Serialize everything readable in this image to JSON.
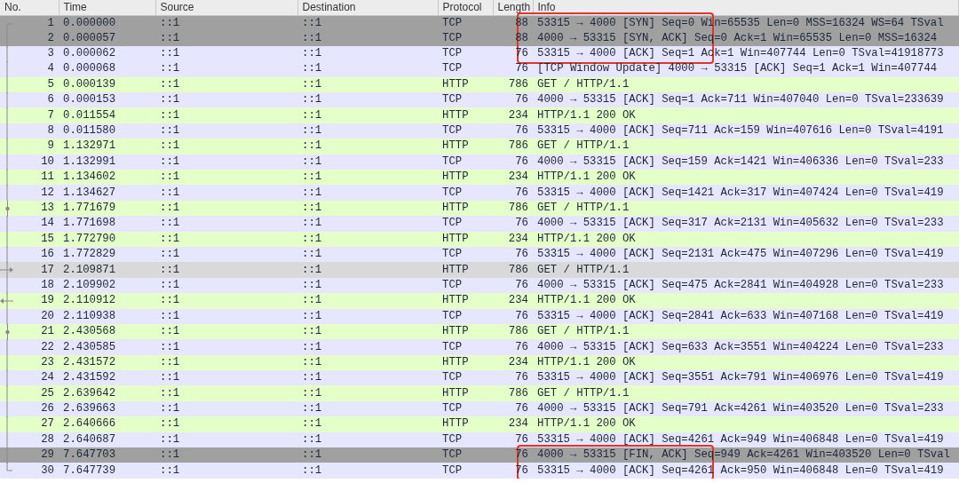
{
  "table": {
    "columns": [
      "No.",
      "Time",
      "Source",
      "Destination",
      "Protocol",
      "Length",
      "Info"
    ],
    "rows": [
      {
        "no": "1",
        "time": "0.000000",
        "source": "::1",
        "destination": "::1",
        "protocol": "TCP",
        "length": "88",
        "info": "53315 → 4000 [SYN] Seq=0 Win=65535 Len=0 MSS=16324 WS=64 TSval",
        "marked": true,
        "selected": false,
        "boxed": true,
        "kind": "first"
      },
      {
        "no": "2",
        "time": "0.000057",
        "source": "::1",
        "destination": "::1",
        "protocol": "TCP",
        "length": "88",
        "info": "4000 → 53315 [SYN, ACK] Seq=0 Ack=1 Win=65535 Len=0 MSS=16324",
        "marked": true,
        "selected": false,
        "boxed": true,
        "kind": "line"
      },
      {
        "no": "3",
        "time": "0.000062",
        "source": "::1",
        "destination": "::1",
        "protocol": "TCP",
        "length": "76",
        "info": "53315 → 4000 [ACK] Seq=1 Ack=1 Win=407744 Len=0 TSval=41918773",
        "color": "#e7e6ff",
        "marked": false,
        "selected": false,
        "boxed": true,
        "kind": "line"
      },
      {
        "no": "4",
        "time": "0.000068",
        "source": "::1",
        "destination": "::1",
        "protocol": "TCP",
        "length": "76",
        "info": "[TCP Window Update] 4000 → 53315 [ACK] Seq=1 Ack=1 Win=407744",
        "color": "#e7e6ff",
        "marked": false,
        "selected": false,
        "boxed": false,
        "kind": "line"
      },
      {
        "no": "5",
        "time": "0.000139",
        "source": "::1",
        "destination": "::1",
        "protocol": "HTTP",
        "length": "786",
        "info": "GET / HTTP/1.1",
        "color": "#e4ffc7",
        "marked": false,
        "selected": false,
        "boxed": false,
        "kind": "line"
      },
      {
        "no": "6",
        "time": "0.000153",
        "source": "::1",
        "destination": "::1",
        "protocol": "TCP",
        "length": "76",
        "info": "4000 → 53315 [ACK] Seq=1 Ack=711 Win=407040 Len=0 TSval=233639",
        "color": "#e7e6ff",
        "marked": false,
        "selected": false,
        "boxed": false,
        "kind": "line"
      },
      {
        "no": "7",
        "time": "0.011554",
        "source": "::1",
        "destination": "::1",
        "protocol": "HTTP",
        "length": "234",
        "info": "HTTP/1.1 200 OK",
        "color": "#e4ffc7",
        "marked": false,
        "selected": false,
        "boxed": false,
        "kind": "line"
      },
      {
        "no": "8",
        "time": "0.011580",
        "source": "::1",
        "destination": "::1",
        "protocol": "TCP",
        "length": "76",
        "info": "53315 → 4000 [ACK] Seq=711 Ack=159 Win=407616 Len=0 TSval=4191",
        "color": "#e7e6ff",
        "marked": false,
        "selected": false,
        "boxed": false,
        "kind": "line"
      },
      {
        "no": "9",
        "time": "1.132971",
        "source": "::1",
        "destination": "::1",
        "protocol": "HTTP",
        "length": "786",
        "info": "GET / HTTP/1.1",
        "color": "#e4ffc7",
        "marked": false,
        "selected": false,
        "boxed": false,
        "kind": "line"
      },
      {
        "no": "10",
        "time": "1.132991",
        "source": "::1",
        "destination": "::1",
        "protocol": "TCP",
        "length": "76",
        "info": "4000 → 53315 [ACK] Seq=159 Ack=1421 Win=406336 Len=0 TSval=233",
        "color": "#e7e6ff",
        "marked": false,
        "selected": false,
        "boxed": false,
        "kind": "line"
      },
      {
        "no": "11",
        "time": "1.134602",
        "source": "::1",
        "destination": "::1",
        "protocol": "HTTP",
        "length": "234",
        "info": "HTTP/1.1 200 OK",
        "color": "#e4ffc7",
        "marked": false,
        "selected": false,
        "boxed": false,
        "kind": "line"
      },
      {
        "no": "12",
        "time": "1.134627",
        "source": "::1",
        "destination": "::1",
        "protocol": "TCP",
        "length": "76",
        "info": "53315 → 4000 [ACK] Seq=1421 Ack=317 Win=407424 Len=0 TSval=419",
        "color": "#e7e6ff",
        "marked": false,
        "selected": false,
        "boxed": false,
        "kind": "line"
      },
      {
        "no": "13",
        "time": "1.771679",
        "source": "::1",
        "destination": "::1",
        "protocol": "HTTP",
        "length": "786",
        "info": "GET / HTTP/1.1",
        "color": "#e4ffc7",
        "marked": false,
        "selected": false,
        "boxed": false,
        "kind": "dot"
      },
      {
        "no": "14",
        "time": "1.771698",
        "source": "::1",
        "destination": "::1",
        "protocol": "TCP",
        "length": "76",
        "info": "4000 → 53315 [ACK] Seq=317 Ack=2131 Win=405632 Len=0 TSval=233",
        "color": "#e7e6ff",
        "marked": false,
        "selected": false,
        "boxed": false,
        "kind": "line"
      },
      {
        "no": "15",
        "time": "1.772790",
        "source": "::1",
        "destination": "::1",
        "protocol": "HTTP",
        "length": "234",
        "info": "HTTP/1.1 200 OK",
        "color": "#e4ffc7",
        "marked": false,
        "selected": false,
        "boxed": false,
        "kind": "line"
      },
      {
        "no": "16",
        "time": "1.772829",
        "source": "::1",
        "destination": "::1",
        "protocol": "TCP",
        "length": "76",
        "info": "53315 → 4000 [ACK] Seq=2131 Ack=475 Win=407296 Len=0 TSval=419",
        "color": "#e7e6ff",
        "marked": false,
        "selected": false,
        "boxed": false,
        "kind": "line"
      },
      {
        "no": "17",
        "time": "2.109871",
        "source": "::1",
        "destination": "::1",
        "protocol": "HTTP",
        "length": "786",
        "info": "GET / HTTP/1.1",
        "marked": false,
        "selected": true,
        "boxed": false,
        "kind": "request"
      },
      {
        "no": "18",
        "time": "2.109902",
        "source": "::1",
        "destination": "::1",
        "protocol": "TCP",
        "length": "76",
        "info": "4000 → 53315 [ACK] Seq=475 Ack=2841 Win=404928 Len=0 TSval=233",
        "color": "#e7e6ff",
        "marked": false,
        "selected": false,
        "boxed": false,
        "kind": "line"
      },
      {
        "no": "19",
        "time": "2.110912",
        "source": "::1",
        "destination": "::1",
        "protocol": "HTTP",
        "length": "234",
        "info": "HTTP/1.1 200 OK",
        "color": "#e4ffc7",
        "marked": false,
        "selected": false,
        "boxed": false,
        "kind": "response"
      },
      {
        "no": "20",
        "time": "2.110938",
        "source": "::1",
        "destination": "::1",
        "protocol": "TCP",
        "length": "76",
        "info": "53315 → 4000 [ACK] Seq=2841 Ack=633 Win=407168 Len=0 TSval=419",
        "color": "#e7e6ff",
        "marked": false,
        "selected": false,
        "boxed": false,
        "kind": "line"
      },
      {
        "no": "21",
        "time": "2.430568",
        "source": "::1",
        "destination": "::1",
        "protocol": "HTTP",
        "length": "786",
        "info": "GET / HTTP/1.1",
        "color": "#e4ffc7",
        "marked": false,
        "selected": false,
        "boxed": false,
        "kind": "dot"
      },
      {
        "no": "22",
        "time": "2.430585",
        "source": "::1",
        "destination": "::1",
        "protocol": "TCP",
        "length": "76",
        "info": "4000 → 53315 [ACK] Seq=633 Ack=3551 Win=404224 Len=0 TSval=233",
        "color": "#e7e6ff",
        "marked": false,
        "selected": false,
        "boxed": false,
        "kind": "line"
      },
      {
        "no": "23",
        "time": "2.431572",
        "source": "::1",
        "destination": "::1",
        "protocol": "HTTP",
        "length": "234",
        "info": "HTTP/1.1 200 OK",
        "color": "#e4ffc7",
        "marked": false,
        "selected": false,
        "boxed": false,
        "kind": "line"
      },
      {
        "no": "24",
        "time": "2.431592",
        "source": "::1",
        "destination": "::1",
        "protocol": "TCP",
        "length": "76",
        "info": "53315 → 4000 [ACK] Seq=3551 Ack=791 Win=406976 Len=0 TSval=419",
        "color": "#e7e6ff",
        "marked": false,
        "selected": false,
        "boxed": false,
        "kind": "line"
      },
      {
        "no": "25",
        "time": "2.639642",
        "source": "::1",
        "destination": "::1",
        "protocol": "HTTP",
        "length": "786",
        "info": "GET / HTTP/1.1",
        "color": "#e4ffc7",
        "marked": false,
        "selected": false,
        "boxed": false,
        "kind": "line"
      },
      {
        "no": "26",
        "time": "2.639663",
        "source": "::1",
        "destination": "::1",
        "protocol": "TCP",
        "length": "76",
        "info": "4000 → 53315 [ACK] Seq=791 Ack=4261 Win=403520 Len=0 TSval=233",
        "color": "#e7e6ff",
        "marked": false,
        "selected": false,
        "boxed": false,
        "kind": "line"
      },
      {
        "no": "27",
        "time": "2.640666",
        "source": "::1",
        "destination": "::1",
        "protocol": "HTTP",
        "length": "234",
        "info": "HTTP/1.1 200 OK",
        "color": "#e4ffc7",
        "marked": false,
        "selected": false,
        "boxed": false,
        "kind": "line"
      },
      {
        "no": "28",
        "time": "2.640687",
        "source": "::1",
        "destination": "::1",
        "protocol": "TCP",
        "length": "76",
        "info": "53315 → 4000 [ACK] Seq=4261 Ack=949 Win=406848 Len=0 TSval=419",
        "color": "#e7e6ff",
        "marked": false,
        "selected": false,
        "boxed": false,
        "kind": "line"
      },
      {
        "no": "29",
        "time": "7.647703",
        "source": "::1",
        "destination": "::1",
        "protocol": "TCP",
        "length": "76",
        "info": "4000 → 53315 [FIN, ACK] Seq=949 Ack=4261 Win=403520 Len=0 TSval",
        "marked": true,
        "selected": false,
        "boxed": true,
        "kind": "line"
      },
      {
        "no": "30",
        "time": "7.647739",
        "source": "::1",
        "destination": "::1",
        "protocol": "TCP",
        "length": "76",
        "info": "53315 → 4000 [ACK] Seq=4261 Ack=950 Win=406848 Len=0 TSval=419",
        "color": "#e7e6ff",
        "marked": false,
        "selected": false,
        "boxed": true,
        "kind": "last"
      }
    ]
  }
}
